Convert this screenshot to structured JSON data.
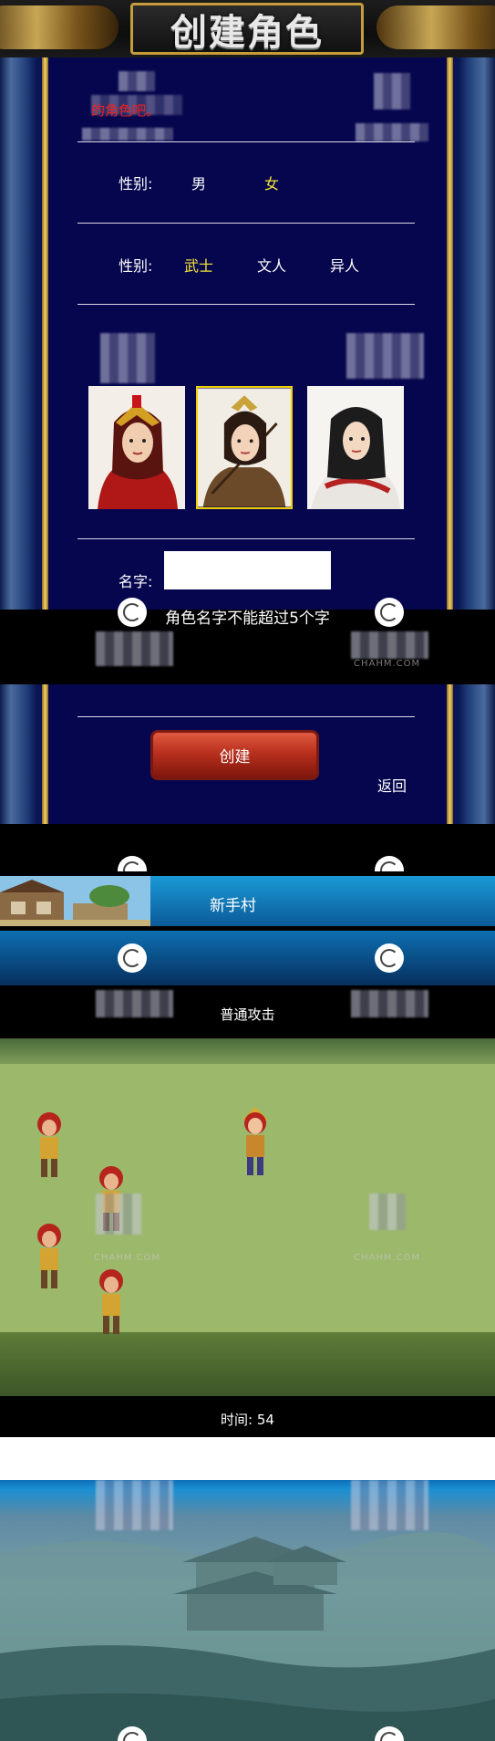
{
  "create_role": {
    "title": "创建角色",
    "welcome_text": "的角色吧。",
    "gender_label": "性别:",
    "gender_options": [
      "男",
      "女"
    ],
    "gender_selected": "女",
    "class_label": "性别:",
    "class_options": [
      "武士",
      "文人",
      "异人"
    ],
    "class_selected": "武士",
    "name_label": "名字:",
    "name_value": "",
    "hint": "角色名字不能超过5个字",
    "create_label": "创建",
    "back_label": "返回",
    "selected_portrait": 2
  },
  "battle": {
    "location": "新手村",
    "attack_label": "普通攻击",
    "time_label": "时间: 54"
  },
  "watermark_text": "CHAHM.COM"
}
